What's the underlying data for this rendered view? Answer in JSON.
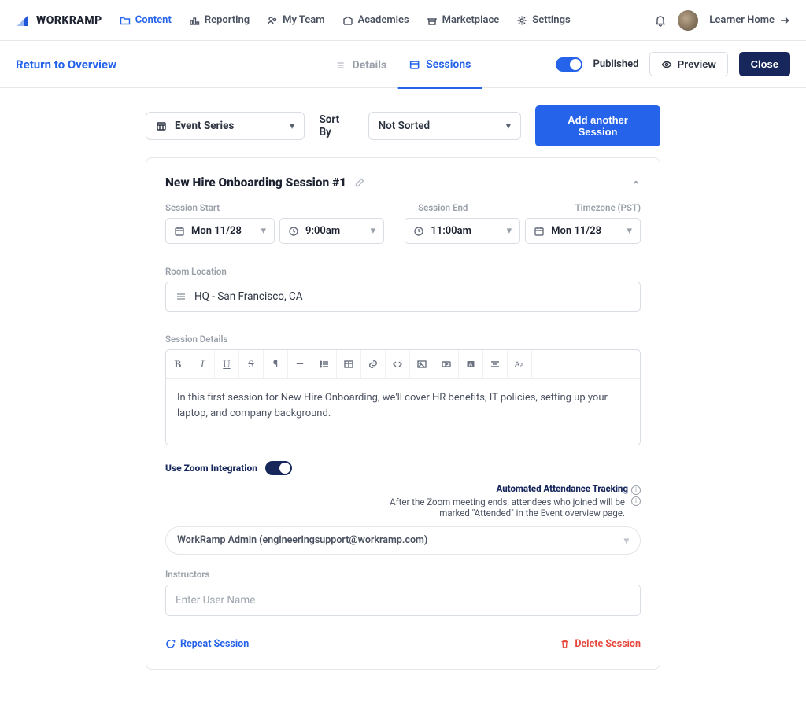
{
  "brand": "WORKRAMP",
  "nav": {
    "content": "Content",
    "reporting": "Reporting",
    "myteam": "My Team",
    "academies": "Academies",
    "marketplace": "Marketplace",
    "settings": "Settings",
    "learner_home": "Learner Home"
  },
  "subbar": {
    "return": "Return to Overview",
    "tab_details": "Details",
    "tab_sessions": "Sessions",
    "published": "Published",
    "preview": "Preview",
    "close": "Close"
  },
  "controls": {
    "series": "Event Series",
    "sort_by": "Sort By",
    "sort_value": "Not Sorted",
    "add_session": "Add another Session"
  },
  "session": {
    "title": "New Hire Onboarding Session #1",
    "labels": {
      "start": "Session Start",
      "end": "Session End",
      "timezone": "Timezone (PST)"
    },
    "start_date": "Mon 11/28",
    "start_time": "9:00am",
    "end_time": "11:00am",
    "end_date": "Mon 11/28",
    "room_label": "Room Location",
    "room_value": "HQ - San Francisco, CA",
    "details_label": "Session Details",
    "details_body": "In this first session for New Hire Onboarding, we'll cover HR benefits, IT policies, setting up your laptop, and company background.",
    "zoom_label": "Use Zoom Integration",
    "auto_track_header": "Automated Attendance Tracking",
    "auto_track_body": "After the Zoom meeting ends, attendees who joined will be marked \"Attended\" in the Event overview page.",
    "admin": "WorkRamp Admin (engineeringsupport@workramp.com)",
    "instructors_label": "Instructors",
    "instructors_placeholder": "Enter User Name",
    "repeat": "Repeat Session",
    "delete": "Delete Session"
  }
}
